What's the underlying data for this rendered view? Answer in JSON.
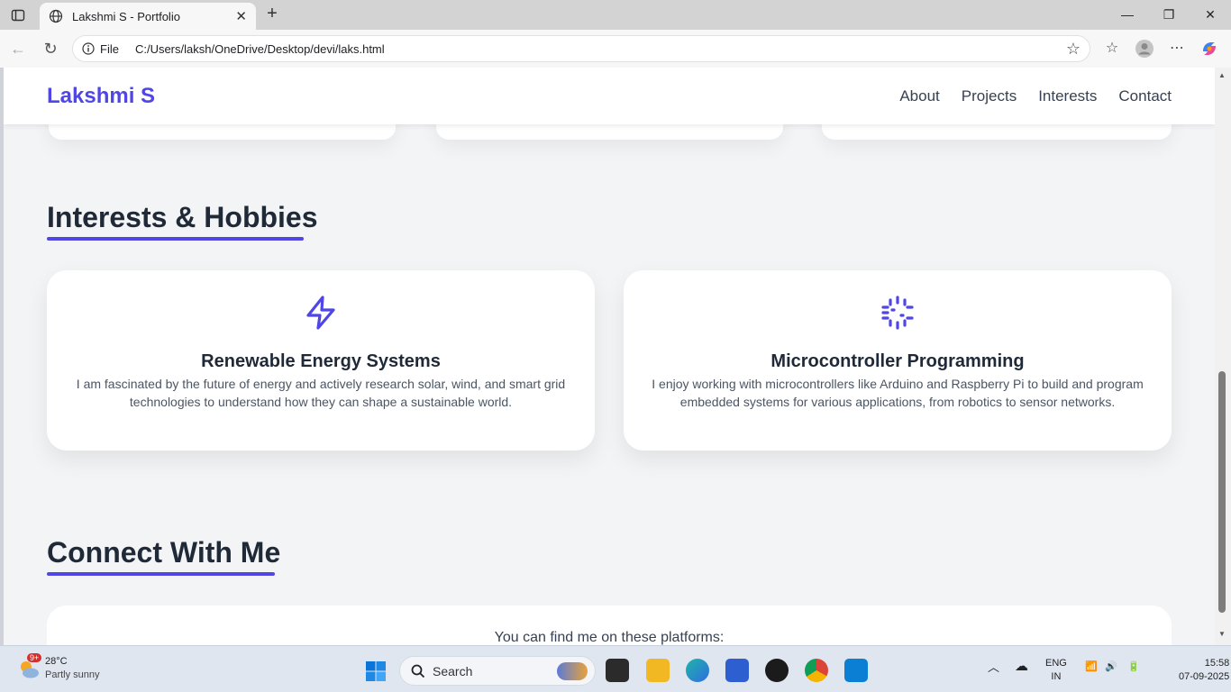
{
  "browser": {
    "tab_title": "Lakshmi S - Portfolio",
    "address_info": "File",
    "url": "C:/Users/laksh/OneDrive/Desktop/devi/laks.html"
  },
  "site": {
    "logo": "Lakshmi S",
    "nav": [
      "About",
      "Projects",
      "Interests",
      "Contact"
    ]
  },
  "interests": {
    "title": "Interests & Hobbies",
    "cards": [
      {
        "icon": "lightning-icon",
        "title": "Renewable Energy Systems",
        "text": "I am fascinated by the future of energy and actively research solar, wind, and smart grid technologies to understand how they can shape a sustainable world."
      },
      {
        "icon": "chip-icon",
        "title": "Microcontroller Programming",
        "text": "I enjoy working with microcontrollers like Arduino and Raspberry Pi to build and program embedded systems for various applications, from robotics to sensor networks."
      }
    ]
  },
  "connect": {
    "title": "Connect With Me",
    "text": "You can find me on these platforms:"
  },
  "taskbar": {
    "weather_badge": "9+",
    "temp": "28°C",
    "condition": "Partly sunny",
    "search": "Search",
    "lang1": "ENG",
    "lang2": "IN",
    "time": "15:58",
    "date": "07-09-2025"
  },
  "colors": {
    "accent": "#4f46e5",
    "page_bg": "#f3f4f6"
  }
}
